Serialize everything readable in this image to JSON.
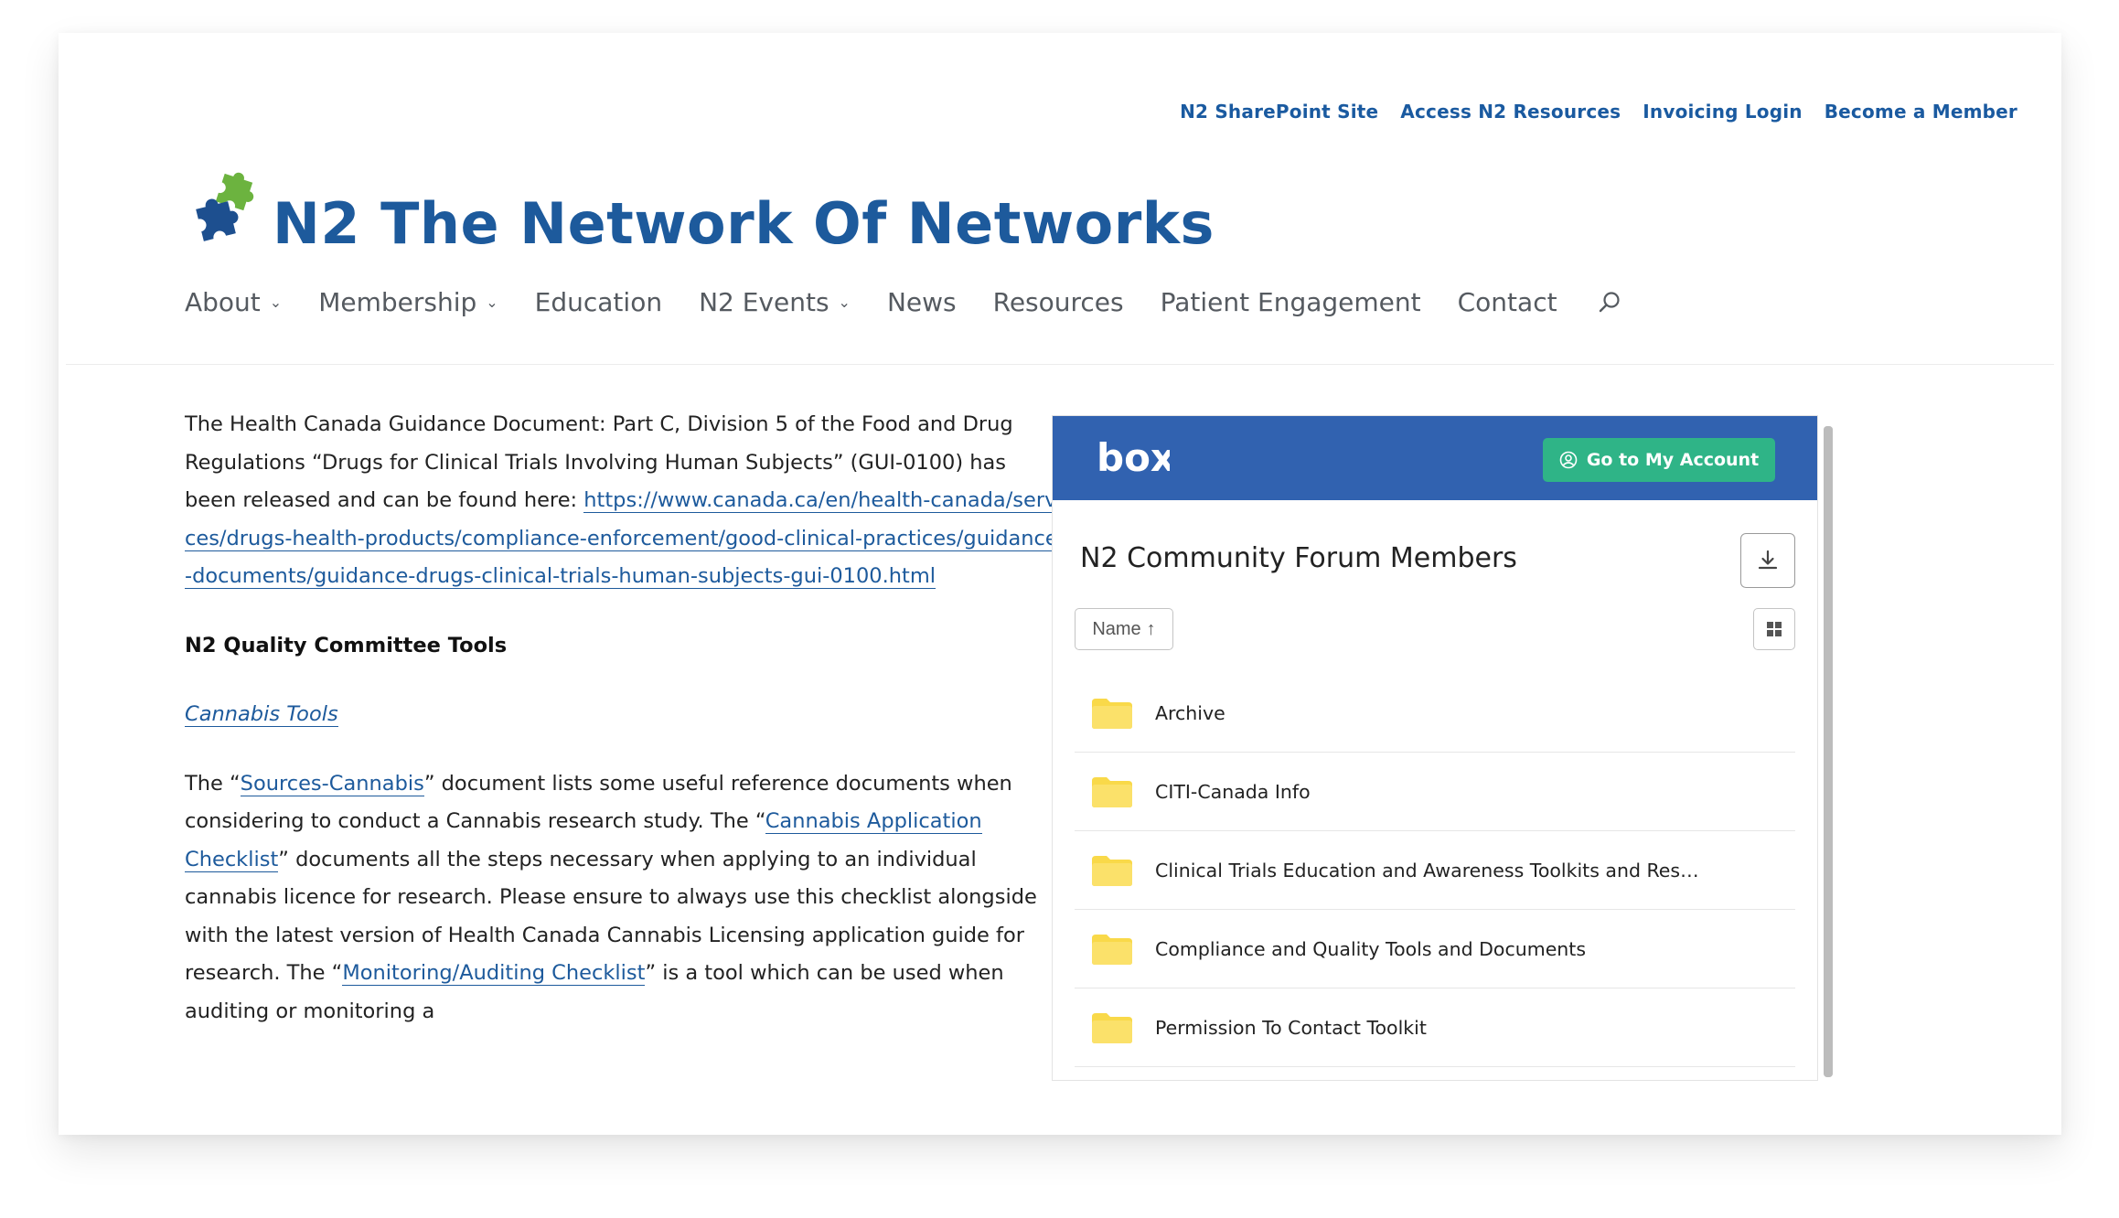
{
  "top_links": [
    {
      "label": "N2 SharePoint Site"
    },
    {
      "label": "Access N2 Resources"
    },
    {
      "label": "Invoicing Login"
    },
    {
      "label": "Become a Member"
    }
  ],
  "logo": {
    "text": "N2 The Network Of Networks"
  },
  "nav": [
    {
      "label": "About",
      "dropdown": true
    },
    {
      "label": "Membership",
      "dropdown": true
    },
    {
      "label": "Education",
      "dropdown": false
    },
    {
      "label": "N2 Events",
      "dropdown": true
    },
    {
      "label": "News",
      "dropdown": false
    },
    {
      "label": "Resources",
      "dropdown": false
    },
    {
      "label": "Patient Engagement",
      "dropdown": false
    },
    {
      "label": "Contact",
      "dropdown": false
    }
  ],
  "article": {
    "p1_text": "The Health Canada Guidance Document: Part C, Division 5 of the Food and Drug Regulations “Drugs for Clinical Trials Involving Human Subjects” (GUI-0100) has been released and can be found here: ",
    "p1_link": "https://www.canada.ca/en/health-canada/services/drugs-health-products/compliance-enforcement/good-clinical-practices/guidance-documents/guidance-drugs-clinical-trials-human-subjects-gui-0100.html",
    "heading": "N2 Quality Committee Tools",
    "cannabis_link": "Cannabis Tools",
    "p3_a": "The “",
    "p3_link1": "Sources-Cannabis",
    "p3_b": "” document lists some useful reference documents when considering to conduct a Cannabis research study. The “",
    "p3_link2": "Cannabis Application Checklist",
    "p3_c": "” documents all the steps necessary when applying to an individual cannabis licence for research. Please ensure to always use this checklist alongside with the latest version of Health Canada Cannabis Licensing application guide for research.  The “",
    "p3_link3": "Monitoring/Auditing Checklist",
    "p3_d": "” is a tool which can be used when auditing or monitoring a"
  },
  "box_widget": {
    "logo_text": "box",
    "go_button": "Go to My Account",
    "title": "N2 Community Forum Members",
    "sort_label": "Name",
    "folders": [
      {
        "name": "Archive"
      },
      {
        "name": "CITI-Canada Info"
      },
      {
        "name": "Clinical Trials Education and Awareness Toolkits and Resou..."
      },
      {
        "name": "Compliance and Quality Tools and Documents"
      },
      {
        "name": "Permission To Contact Toolkit"
      }
    ],
    "colors": {
      "header": "#3162b0",
      "button": "#2fb487",
      "folder": "#f9d949"
    }
  },
  "colors": {
    "brand_blue": "#1d5a9c",
    "nav_gray": "#555a60",
    "logo_green": "#6cb33f"
  }
}
